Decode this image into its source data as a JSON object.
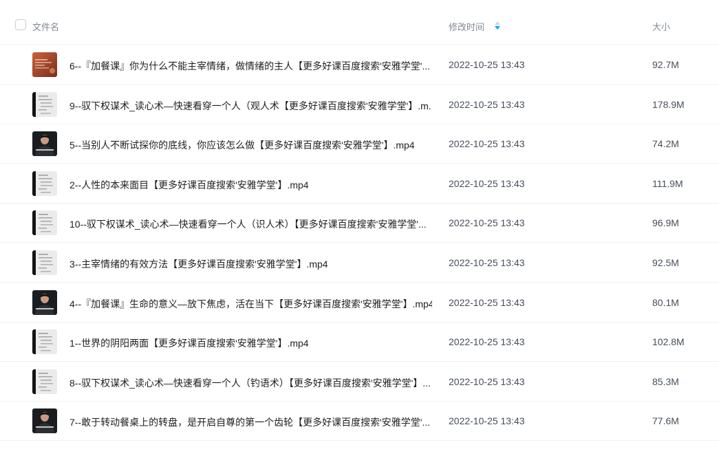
{
  "header": {
    "name_label": "文件名",
    "time_label": "修改时间",
    "size_label": "大小",
    "sort_icon": "sort-up-down-icon"
  },
  "colors": {
    "accent": "#06a7ff"
  },
  "files": [
    {
      "name": "6--『加餐课』你为什么不能主宰情绪，做情绪的主人【更多好课百度搜索'安雅学堂'...",
      "time": "2022-10-25 13:43",
      "size": "92.7M",
      "thumb": "orange-warm"
    },
    {
      "name": "9--驭下权谋术_读心术—快速看穿一个人（观人术【更多好课百度搜索'安雅学堂'】.m...",
      "time": "2022-10-25 13:43",
      "size": "178.9M",
      "thumb": "doc"
    },
    {
      "name": "5--当别人不断试探你的底线，你应该怎么做【更多好课百度搜索'安雅学堂'】.mp4",
      "time": "2022-10-25 13:43",
      "size": "74.2M",
      "thumb": "speaker"
    },
    {
      "name": "2--人性的本来面目【更多好课百度搜索'安雅学堂'】.mp4",
      "time": "2022-10-25 13:43",
      "size": "111.9M",
      "thumb": "doc"
    },
    {
      "name": "10--驭下权谋术_读心术—快速看穿一个人（识人术）【更多好课百度搜索'安雅学堂'...",
      "time": "2022-10-25 13:43",
      "size": "96.9M",
      "thumb": "doc"
    },
    {
      "name": "3--主宰情绪的有效方法【更多好课百度搜索'安雅学堂'】.mp4",
      "time": "2022-10-25 13:43",
      "size": "92.5M",
      "thumb": "doc"
    },
    {
      "name": "4--『加餐课』生命的意义—放下焦虑，活在当下【更多好课百度搜索'安雅学堂'】.mp4",
      "time": "2022-10-25 13:43",
      "size": "80.1M",
      "thumb": "speaker"
    },
    {
      "name": "1--世界的阴阳两面【更多好课百度搜索'安雅学堂'】.mp4",
      "time": "2022-10-25 13:43",
      "size": "102.8M",
      "thumb": "doc"
    },
    {
      "name": "8--驭下权谋术_读心术—快速看穿一个人（钓语术）【更多好课百度搜索'安雅学堂'】...",
      "time": "2022-10-25 13:43",
      "size": "85.3M",
      "thumb": "doc"
    },
    {
      "name": "7--敢于转动餐桌上的转盘，是开启自尊的第一个齿轮【更多好课百度搜索'安雅学堂'...",
      "time": "2022-10-25 13:43",
      "size": "77.6M",
      "thumb": "speaker"
    }
  ]
}
